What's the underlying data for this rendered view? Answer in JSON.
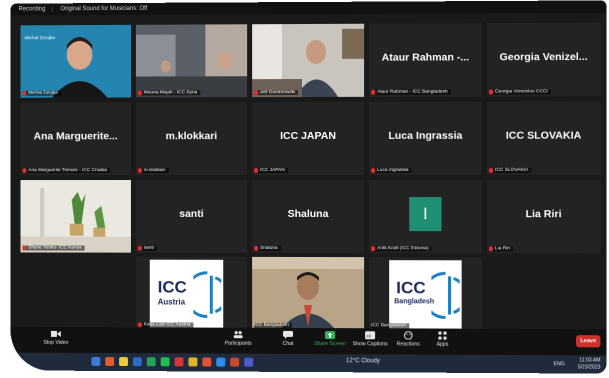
{
  "topbar": {
    "recording": "Recording",
    "original_sound": "Original Sound for Musicians: Off"
  },
  "tiles": [
    {
      "label": "Michal Dzujka",
      "video_title": "Michal Dzujka"
    },
    {
      "label": "Mouna Mejah - ICC Syria"
    },
    {
      "label": "Jeff Dombrowski"
    },
    {
      "name": "Ataur Rahman -...",
      "label": "Ataur Rahman - ICC Bangladesh"
    },
    {
      "name": "Georgia Venizel...",
      "label": "Georgia Venizelou CCCI"
    },
    {
      "name": "Ana Marguerite...",
      "label": "Ana Marguerite Tomulić - ICC Croatia"
    },
    {
      "name": "m.klokkari",
      "label": "m.klokkari"
    },
    {
      "name": "ICC JAPAN",
      "label": "ICC JAPAN"
    },
    {
      "name": "Luca Ingrassia",
      "label": "Luca Ingrassia"
    },
    {
      "name": "ICC SLOVAKIA",
      "label": "ICC SLOVAKIA"
    },
    {
      "label": "Shyne Yeshu- ICC Kenya"
    },
    {
      "name": "santi",
      "label": "santi"
    },
    {
      "name": "Shaluna",
      "label": "Shaluna"
    },
    {
      "avatar": "I",
      "label": "Antti Kraft (ICC Estonia)"
    },
    {
      "name": "Lia Riri",
      "label": "Lia Riri"
    },
    {
      "logo_top": "ICC",
      "logo_bottom": "Austria",
      "label": "Katja Lutz ICC Austria"
    },
    {
      "label": "ICC Bangladesh"
    },
    {
      "logo_top": "ICC",
      "logo_bottom": "Bangladesh",
      "label": "ICC Bangladesh"
    }
  ],
  "controls": {
    "video": "Stop Video",
    "participants": "Participants",
    "participants_count": "18",
    "chat": "Chat",
    "share": "Share Screen",
    "captions": "Show Captions",
    "reactions": "Reactions",
    "apps": "Apps",
    "leave": "Leave"
  },
  "taskbar": {
    "weather": "12°C Cloudy",
    "language": "ENG",
    "time": "11:03 AM",
    "date": "5/23/2023"
  },
  "colors": {
    "tile_bg": "#232323",
    "active_border": "#c9d64a",
    "leave": "#d0312d",
    "share": "#2fb35a",
    "avatar": "#1e8f73"
  }
}
